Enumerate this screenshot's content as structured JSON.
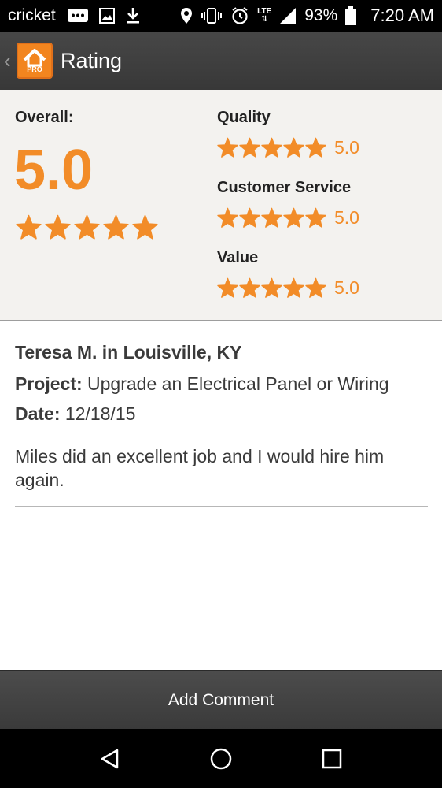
{
  "status_bar": {
    "carrier": "cricket",
    "lte": "LTE",
    "battery": "93%",
    "time": "7:20 AM"
  },
  "header": {
    "back_icon": "chevron-left-icon",
    "logo_badge": "PRO",
    "title": "Rating"
  },
  "rating": {
    "overall_label": "Overall:",
    "overall_value": "5.0",
    "overall_stars": 5,
    "star_color": "#f28c28",
    "categories": [
      {
        "label": "Quality",
        "stars": 5,
        "value": "5.0"
      },
      {
        "label": "Customer Service",
        "stars": 5,
        "value": "5.0"
      },
      {
        "label": "Value",
        "stars": 5,
        "value": "5.0"
      }
    ]
  },
  "review": {
    "author": "Teresa M. in Louisville, KY",
    "project_label": "Project:",
    "project_value": "Upgrade an Electrical Panel or Wiring",
    "date_label": "Date:",
    "date_value": "12/18/15",
    "text": "Miles did an excellent job and I would hire him again."
  },
  "footer": {
    "add_comment_label": "Add Comment"
  },
  "nav": {
    "back": "back-triangle-icon",
    "home": "home-circle-icon",
    "recents": "recents-square-icon"
  }
}
